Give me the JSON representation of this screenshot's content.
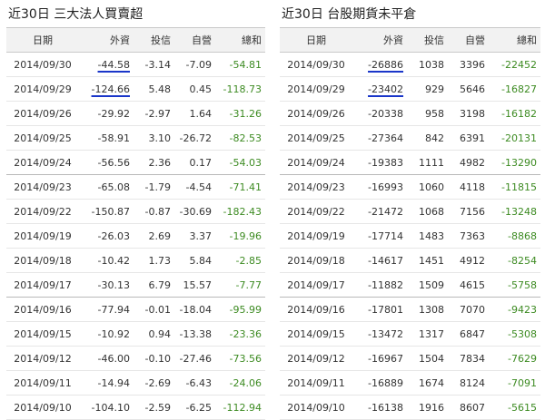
{
  "left": {
    "title": "近30日 三大法人買賣超",
    "headers": [
      "日期",
      "外資",
      "投信",
      "自營",
      "總和"
    ],
    "underlined_column": 1,
    "underlined_rows": [
      0,
      1
    ],
    "rows": [
      [
        "2014/09/30",
        "-44.58",
        "-3.14",
        "-7.09",
        "-54.81"
      ],
      [
        "2014/09/29",
        "-124.66",
        "5.48",
        "0.45",
        "-118.73"
      ],
      [
        "2014/09/26",
        "-29.92",
        "-2.97",
        "1.64",
        "-31.26"
      ],
      [
        "2014/09/25",
        "-58.91",
        "3.10",
        "-26.72",
        "-82.53"
      ],
      [
        "2014/09/24",
        "-56.56",
        "2.36",
        "0.17",
        "-54.03"
      ],
      [
        "2014/09/23",
        "-65.08",
        "-1.79",
        "-4.54",
        "-71.41"
      ],
      [
        "2014/09/22",
        "-150.87",
        "-0.87",
        "-30.69",
        "-182.43"
      ],
      [
        "2014/09/19",
        "-26.03",
        "2.69",
        "3.37",
        "-19.96"
      ],
      [
        "2014/09/18",
        "-10.42",
        "1.73",
        "5.84",
        "-2.85"
      ],
      [
        "2014/09/17",
        "-30.13",
        "6.79",
        "15.57",
        "-7.77"
      ],
      [
        "2014/09/16",
        "-77.94",
        "-0.01",
        "-18.04",
        "-95.99"
      ],
      [
        "2014/09/15",
        "-10.92",
        "0.94",
        "-13.38",
        "-23.36"
      ],
      [
        "2014/09/12",
        "-46.00",
        "-0.10",
        "-27.46",
        "-73.56"
      ],
      [
        "2014/09/11",
        "-14.94",
        "-2.69",
        "-6.43",
        "-24.06"
      ],
      [
        "2014/09/10",
        "-104.10",
        "-2.59",
        "-6.25",
        "-112.94"
      ]
    ]
  },
  "right": {
    "title": "近30日 台股期貨未平倉",
    "headers": [
      "日期",
      "外資",
      "投信",
      "自營",
      "總和"
    ],
    "underlined_column": 1,
    "underlined_rows": [
      0,
      1
    ],
    "rows": [
      [
        "2014/09/30",
        "-26886",
        "1038",
        "3396",
        "-22452"
      ],
      [
        "2014/09/29",
        "-23402",
        "929",
        "5646",
        "-16827"
      ],
      [
        "2014/09/26",
        "-20338",
        "958",
        "3198",
        "-16182"
      ],
      [
        "2014/09/25",
        "-27364",
        "842",
        "6391",
        "-20131"
      ],
      [
        "2014/09/24",
        "-19383",
        "1111",
        "4982",
        "-13290"
      ],
      [
        "2014/09/23",
        "-16993",
        "1060",
        "4118",
        "-11815"
      ],
      [
        "2014/09/22",
        "-21472",
        "1068",
        "7156",
        "-13248"
      ],
      [
        "2014/09/19",
        "-17714",
        "1483",
        "7363",
        "-8868"
      ],
      [
        "2014/09/18",
        "-14617",
        "1451",
        "4912",
        "-8254"
      ],
      [
        "2014/09/17",
        "-11882",
        "1509",
        "4615",
        "-5758"
      ],
      [
        "2014/09/16",
        "-17801",
        "1308",
        "7070",
        "-9423"
      ],
      [
        "2014/09/15",
        "-13472",
        "1317",
        "6847",
        "-5308"
      ],
      [
        "2014/09/12",
        "-16967",
        "1504",
        "7834",
        "-7629"
      ],
      [
        "2014/09/11",
        "-16889",
        "1674",
        "8124",
        "-7091"
      ],
      [
        "2014/09/10",
        "-16138",
        "1916",
        "8607",
        "-5615"
      ]
    ]
  },
  "colors": {
    "total": "#3d8b22",
    "underline": "#1a36c9",
    "header_bg": "#f2f2f2"
  }
}
